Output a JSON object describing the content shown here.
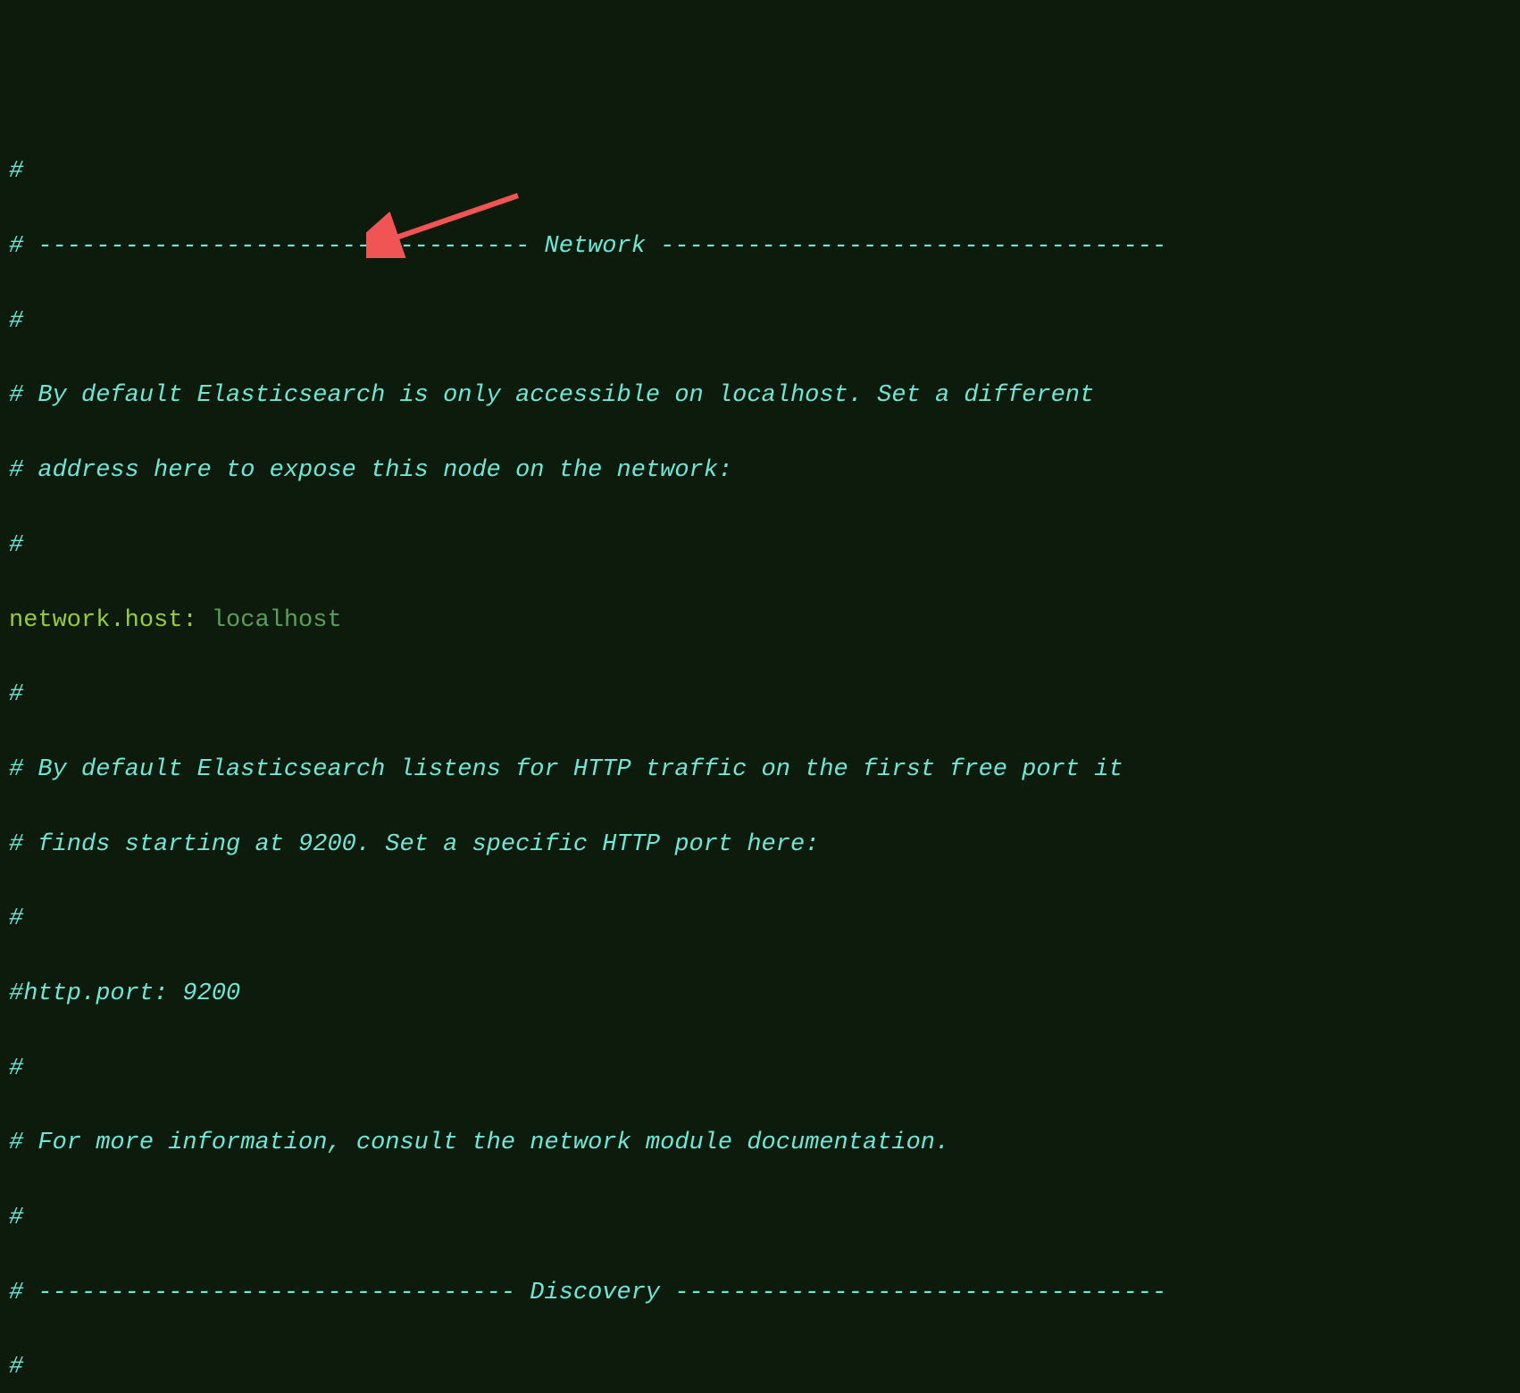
{
  "lines": {
    "l1": "#",
    "l2": "# ---------------------------------- Network -----------------------------------",
    "l3": "#",
    "l4": "# By default Elasticsearch is only accessible on localhost. Set a different",
    "l5": "# address here to expose this node on the network:",
    "l6": "#",
    "l7_key": "network.host",
    "l7_colon": ": ",
    "l7_value": "localhost",
    "l8": "#",
    "l9": "# By default Elasticsearch listens for HTTP traffic on the first free port it",
    "l10": "# finds starting at 9200. Set a specific HTTP port here:",
    "l11": "#",
    "l12": "#http.port: 9200",
    "l13": "#",
    "l14": "# For more information, consult the network module documentation.",
    "l15": "#",
    "l16": "# --------------------------------- Discovery ----------------------------------",
    "l17": "#"
  },
  "annotation": {
    "arrow_color": "#f05454"
  }
}
